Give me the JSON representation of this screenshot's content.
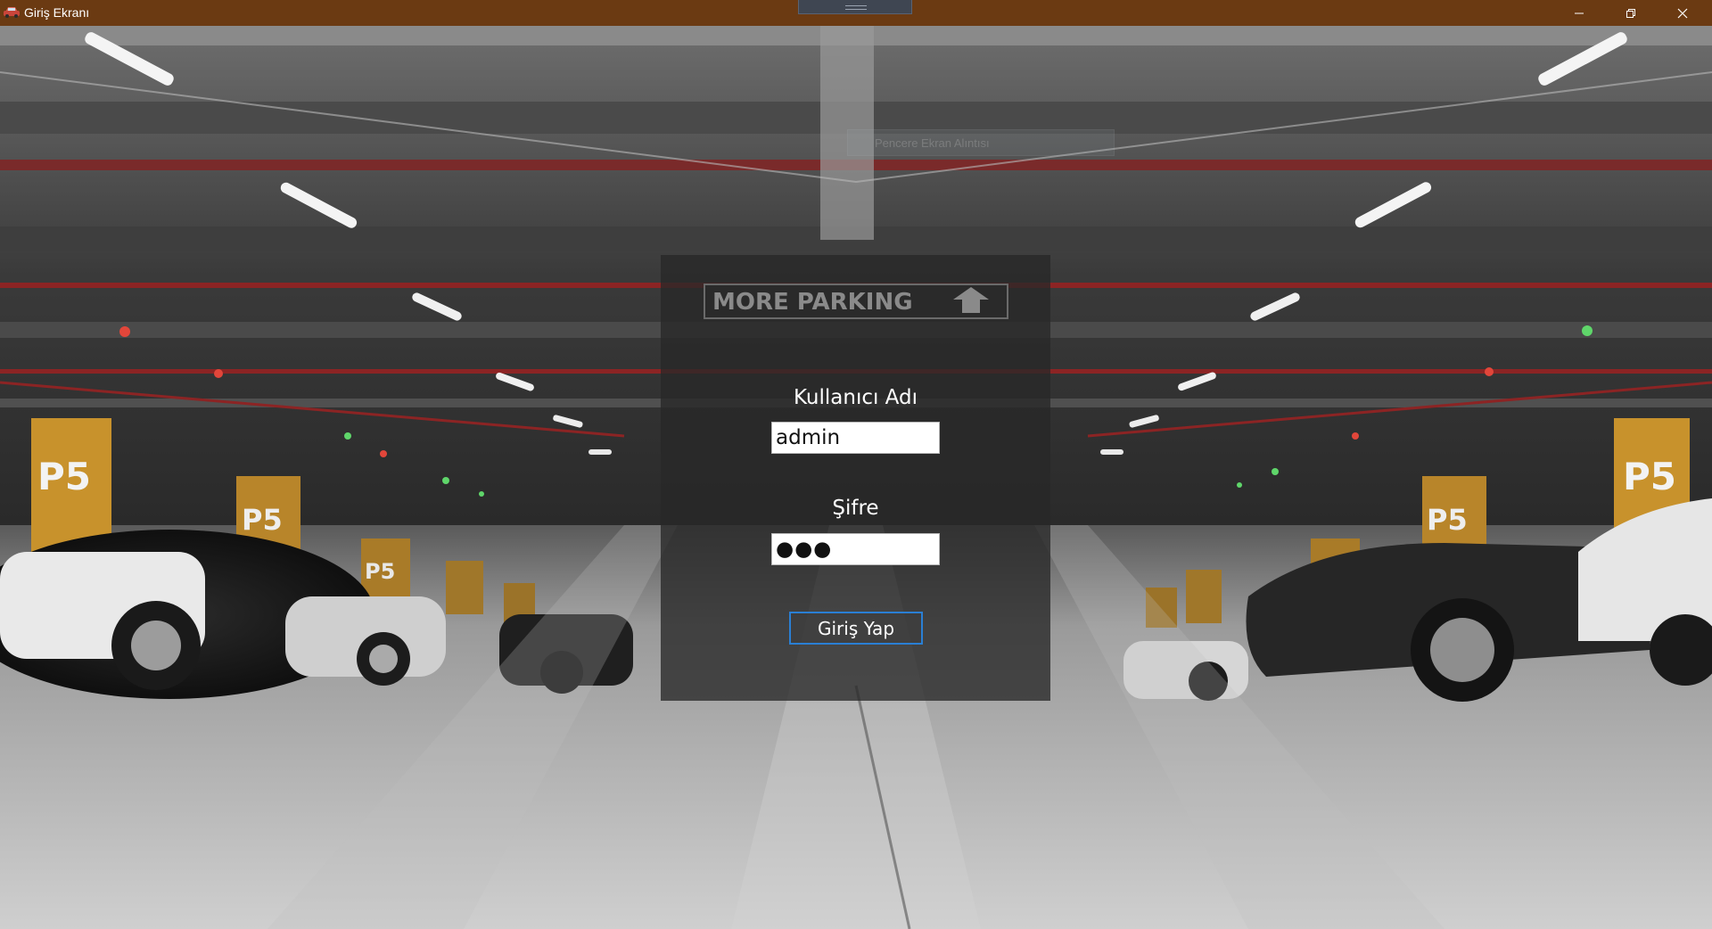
{
  "window": {
    "title": "Giriş Ekranı",
    "titlebar_color": "#6b3a12",
    "icons": {
      "app": "car-icon",
      "minimize": "minimize-icon",
      "maximize": "restore-icon",
      "close": "close-icon"
    }
  },
  "background": {
    "scene": "parking-garage-photo",
    "sign_text": "MORE PARKING",
    "pillar_labels": [
      "P5",
      "P5",
      "P5",
      "P5",
      "P5",
      "P5"
    ]
  },
  "tooltip": {
    "text": "Pencere Ekran Alıntısı"
  },
  "login": {
    "username_label": "Kullanıcı Adı",
    "username_value": "admin",
    "password_label": "Şifre",
    "password_value": "●●●",
    "submit_label": "Giriş Yap",
    "accent_color": "#2a7fd4"
  }
}
